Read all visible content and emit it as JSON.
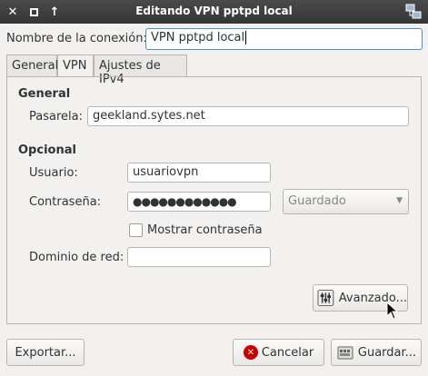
{
  "window": {
    "title": "Editando VPN pptpd local"
  },
  "connection": {
    "name_label": "Nombre de la conexión:",
    "name_value": "VPN pptpd local"
  },
  "tabs": [
    {
      "label": "General"
    },
    {
      "label": "VPN"
    },
    {
      "label": "Ajustes de IPv4"
    }
  ],
  "general": {
    "heading": "General",
    "gateway_label": "Pasarela:",
    "gateway_value": "geekland.sytes.net"
  },
  "optional": {
    "heading": "Opcional",
    "user_label": "Usuario:",
    "user_value": "usuariovpn",
    "password_label": "Contraseña:",
    "password_value": "●●●●●●●●●●●●",
    "password_mode": "Guardado",
    "show_password_label": "Mostrar contraseña",
    "domain_label": "Dominio de red:",
    "domain_value": ""
  },
  "buttons": {
    "advanced": "Avanzado...",
    "export": "Exportar...",
    "cancel": "Cancelar",
    "save": "Guardar..."
  },
  "colors": {
    "titlebar": "#3c3c3c",
    "focus": "#4a90d9",
    "cancel_icon": "#cc0000"
  }
}
